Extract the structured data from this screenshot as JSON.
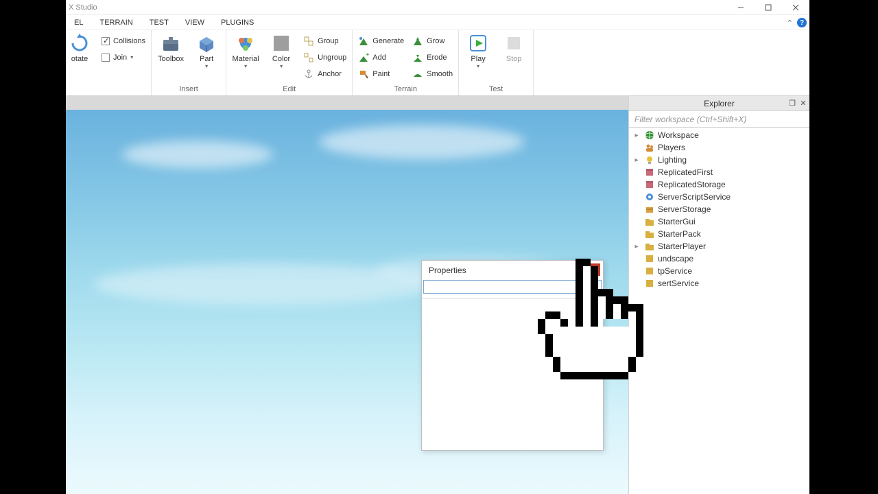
{
  "titlebar": {
    "title": "X Studio"
  },
  "menutabs": [
    "EL",
    "TERRAIN",
    "TEST",
    "VIEW",
    "PLUGINS"
  ],
  "ribbon": {
    "group1": {
      "rotate": "otate",
      "collisions": "Collisions",
      "join": "Join"
    },
    "insert": {
      "label": "Insert",
      "toolbox": "Toolbox",
      "part": "Part"
    },
    "edit": {
      "label": "Edit",
      "material": "Material",
      "color": "Color",
      "group": "Group",
      "ungroup": "Ungroup",
      "anchor": "Anchor"
    },
    "terrain": {
      "label": "Terrain",
      "generate": "Generate",
      "add": "Add",
      "paint": "Paint",
      "grow": "Grow",
      "erode": "Erode",
      "smooth": "Smooth"
    },
    "test": {
      "label": "Test",
      "play": "Play",
      "stop": "Stop"
    }
  },
  "explorer": {
    "title": "Explorer",
    "filter_placeholder": "Filter workspace (Ctrl+Shift+X)",
    "items": [
      {
        "label": "Workspace",
        "expander": true,
        "icon": "globe",
        "fg": "#2f8f2f"
      },
      {
        "label": "Players",
        "expander": false,
        "icon": "people",
        "fg": "#d48a3a"
      },
      {
        "label": "Lighting",
        "expander": true,
        "icon": "bulb",
        "fg": "#e6c23a"
      },
      {
        "label": "ReplicatedFirst",
        "expander": false,
        "icon": "box",
        "fg": "#c96a7a"
      },
      {
        "label": "ReplicatedStorage",
        "expander": false,
        "icon": "box",
        "fg": "#c96a7a"
      },
      {
        "label": "ServerScriptService",
        "expander": false,
        "icon": "gear",
        "fg": "#4a90d9"
      },
      {
        "label": "ServerStorage",
        "expander": false,
        "icon": "box2",
        "fg": "#d8a040"
      },
      {
        "label": "StarterGui",
        "expander": false,
        "icon": "folder",
        "fg": "#d8b040"
      },
      {
        "label": "StarterPack",
        "expander": false,
        "icon": "folder",
        "fg": "#d8b040"
      },
      {
        "label": "StarterPlayer",
        "expander": true,
        "icon": "folder",
        "fg": "#d8b040"
      },
      {
        "label": "undscape",
        "expander": false,
        "icon": "note",
        "fg": "#d8b040"
      },
      {
        "label": "tpService",
        "expander": false,
        "icon": "note",
        "fg": "#d8b040"
      },
      {
        "label": "sertService",
        "expander": false,
        "icon": "note",
        "fg": "#d8b040"
      }
    ]
  },
  "properties": {
    "title": "Properties"
  }
}
